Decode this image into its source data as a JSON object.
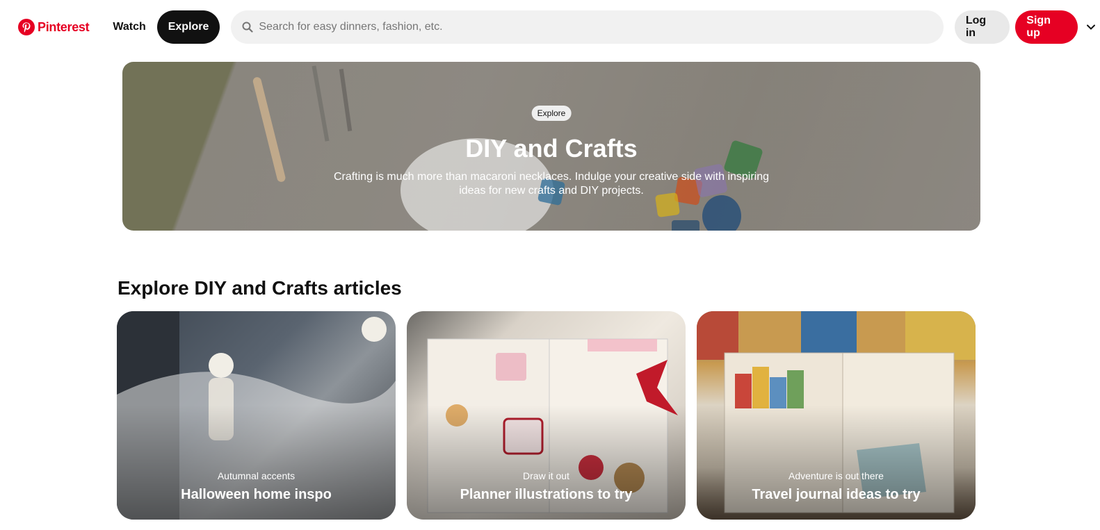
{
  "header": {
    "logo_text": "Pinterest",
    "nav": {
      "watch": "Watch",
      "explore": "Explore"
    },
    "search": {
      "placeholder": "Search for easy dinners, fashion, etc.",
      "value": ""
    },
    "login": "Log in",
    "signup": "Sign up"
  },
  "hero": {
    "badge": "Explore",
    "title": "DIY and Crafts",
    "description": "Crafting is much more than macaroni necklaces. Indulge your creative side with inspiring ideas for new crafts and DIY projects."
  },
  "section": {
    "title": "Explore DIY and Crafts articles",
    "cards": [
      {
        "subtitle": "Autumnal accents",
        "title": "Halloween home inspo"
      },
      {
        "subtitle": "Draw it out",
        "title": "Planner illustrations to try"
      },
      {
        "subtitle": "Adventure is out there",
        "title": "Travel journal ideas to try"
      }
    ]
  },
  "colors": {
    "brand": "#e60023",
    "dark": "#111111",
    "search_bg": "#f1f1f1"
  },
  "icons": [
    "pinterest-logo-icon",
    "search-icon",
    "chevron-down-icon"
  ]
}
